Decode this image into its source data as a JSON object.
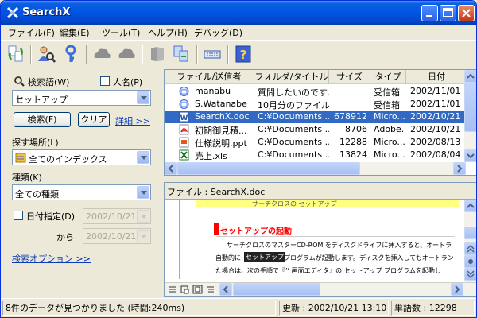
{
  "window": {
    "title": "SearchX"
  },
  "menu": [
    "ファイル(F)",
    "編集(E)",
    "ツール(T)",
    "ヘルプ(H)",
    "デバッグ(D)"
  ],
  "toolbar": {
    "buttons": [
      "refresh-icon",
      "search-person-icon",
      "search-key-icon",
      "cloud-1-icon",
      "cloud-2-icon",
      "folder-icon",
      "copy-icon",
      "keyboard-icon",
      "help-icon"
    ]
  },
  "search": {
    "keyword_label": "検索語(W)",
    "person_label": "人名(P)",
    "keyword_value": "セットアップ",
    "search_button": "検索(F)",
    "clear_button": "クリア",
    "detail_link": "詳細 >>",
    "location_label": "探す場所(L)",
    "location_value": "全てのインデックス",
    "type_label": "種類(K)",
    "type_value": "全ての種類",
    "date_label": "日付指定(D)",
    "date_from": "2002/10/21",
    "from_label": "から",
    "date_to": "2002/10/21",
    "options_link": "検索オプション >>"
  },
  "list": {
    "columns": [
      "ファイル/送信者",
      "フォルダ/タイトル",
      "サイズ",
      "タイプ",
      "日付"
    ],
    "rows": [
      {
        "icon": "mail-icon",
        "name": "manabu",
        "folder": "質問したいのです...",
        "size": "",
        "type": "受信箱",
        "date": "2002/11/01"
      },
      {
        "icon": "mail-icon",
        "name": "S.Watanabe",
        "folder": "10月分のファイル...",
        "size": "",
        "type": "受信箱",
        "date": "2002/11/01"
      },
      {
        "icon": "word-icon",
        "name": "SearchX.doc",
        "folder": "C:¥Documents ...",
        "size": "678912",
        "type": "Micro...",
        "date": "2002/10/21",
        "selected": true
      },
      {
        "icon": "pdf-icon",
        "name": "初期御見積...",
        "folder": "C:¥Documents ...",
        "size": "8706",
        "type": "Adobe...",
        "date": "2002/10/21"
      },
      {
        "icon": "ppt-icon",
        "name": "仕様説明.ppt",
        "folder": "C:¥Documents ...",
        "size": "12288",
        "type": "Micro...",
        "date": "2002/08/13"
      },
      {
        "icon": "excel-icon",
        "name": "売上.xls",
        "folder": "C:¥Documents ...",
        "size": "13824",
        "type": "Micro...",
        "date": "2002/08/04"
      }
    ]
  },
  "preview": {
    "file_label": "ファイル : SearchX.doc",
    "heading": "セットアップの起動",
    "line1": "サーチクロスのマスターCD-ROM をディスクドライブに挿入すると、オートラ",
    "line2_a": "自動的に",
    "line2_hl": "セットアップ",
    "line2_b": "プログラムが起動します。ディスクを挿入してもオートラン",
    "line3": "た場合は、次の手順で『’‘ 画面エディタ』の セットアップ プログラムを起動し",
    "top_text": "サーチクロスの セットアップ"
  },
  "status": {
    "message": "8件のデータが見つかりました (時間:240ms)",
    "updated": "更新 : 2002/10/21 13:10",
    "words": "単語数 : 12298"
  },
  "colors": {
    "titlebar": "#0054e3",
    "selection": "#316ac5",
    "heading_red": "#ff0000",
    "link": "#0b3bb7"
  }
}
